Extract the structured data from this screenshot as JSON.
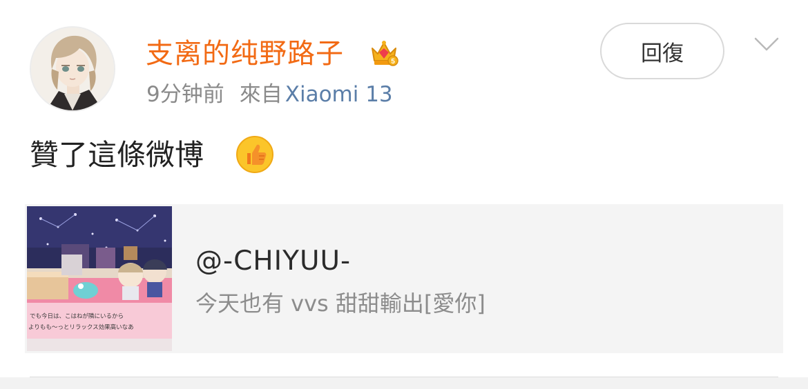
{
  "user": {
    "name": "支离的纯野路子",
    "badge_icon": "crown-vip-icon",
    "avatar_icon": "anime-avatar"
  },
  "meta": {
    "time": "9分钟前",
    "from_label": "來自",
    "device": "Xiaomi 13"
  },
  "actions": {
    "reply_label": "回復",
    "more_icon": "chevron-down-icon"
  },
  "post": {
    "text": "贊了這條微博",
    "emoji_icon": "thumbs-up-emoji"
  },
  "shared_card": {
    "handle": "@-CHIYUU-",
    "description": "今天也有 vvs 甜甜輸出[愛你]",
    "thumbnail_caption_line1": "でも今日は、こはねが隣にいるから",
    "thumbnail_caption_line2": "よりもも〜っとリラックス効果高いなあ"
  },
  "colors": {
    "username": "#f26a14",
    "device": "#5b7ea8",
    "meta": "#8a8a8a",
    "card_bg": "#f4f4f4"
  }
}
